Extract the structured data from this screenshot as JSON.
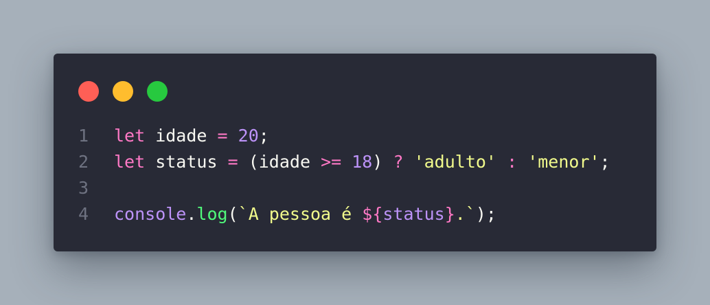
{
  "window": {
    "controls": [
      {
        "name": "close",
        "color": "#ff5f56"
      },
      {
        "name": "minimize",
        "color": "#ffbd2e"
      },
      {
        "name": "maximize",
        "color": "#27c93f"
      }
    ]
  },
  "code": {
    "language": "javascript",
    "lines": [
      {
        "number": "1",
        "tokens": [
          {
            "text": "let",
            "type": "kw"
          },
          {
            "text": " idade ",
            "type": "plain"
          },
          {
            "text": "=",
            "type": "op"
          },
          {
            "text": " ",
            "type": "plain"
          },
          {
            "text": "20",
            "type": "num"
          },
          {
            "text": ";",
            "type": "plain"
          }
        ]
      },
      {
        "number": "2",
        "tokens": [
          {
            "text": "let",
            "type": "kw"
          },
          {
            "text": " status ",
            "type": "plain"
          },
          {
            "text": "=",
            "type": "op"
          },
          {
            "text": " (idade ",
            "type": "plain"
          },
          {
            "text": ">=",
            "type": "op"
          },
          {
            "text": " ",
            "type": "plain"
          },
          {
            "text": "18",
            "type": "num"
          },
          {
            "text": ") ",
            "type": "plain"
          },
          {
            "text": "?",
            "type": "op"
          },
          {
            "text": " ",
            "type": "plain"
          },
          {
            "text": "'adulto'",
            "type": "str"
          },
          {
            "text": " ",
            "type": "plain"
          },
          {
            "text": ":",
            "type": "op"
          },
          {
            "text": " ",
            "type": "plain"
          },
          {
            "text": "'menor'",
            "type": "str"
          },
          {
            "text": ";",
            "type": "plain"
          }
        ]
      },
      {
        "number": "3",
        "tokens": []
      },
      {
        "number": "4",
        "tokens": [
          {
            "text": "console",
            "type": "obj"
          },
          {
            "text": ".",
            "type": "plain"
          },
          {
            "text": "log",
            "type": "fn"
          },
          {
            "text": "(",
            "type": "plain"
          },
          {
            "text": "`A pessoa é ",
            "type": "str"
          },
          {
            "text": "${",
            "type": "interp"
          },
          {
            "text": "status",
            "type": "ivar"
          },
          {
            "text": "}",
            "type": "interp"
          },
          {
            "text": ".`",
            "type": "str"
          },
          {
            "text": ");",
            "type": "plain"
          }
        ]
      }
    ]
  }
}
